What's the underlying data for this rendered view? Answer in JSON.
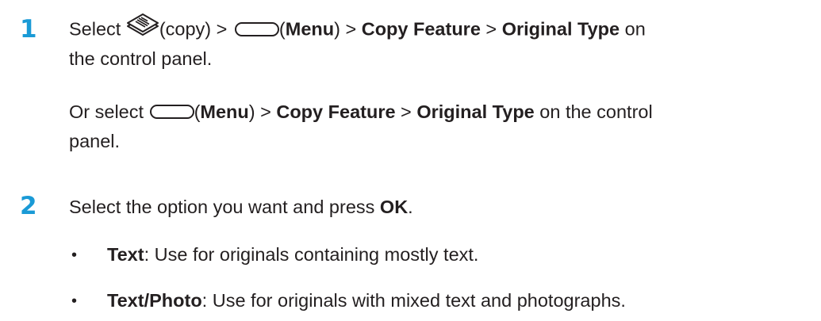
{
  "step1": {
    "number": "1",
    "line1": {
      "t1": "Select ",
      "copy_icon": "copy-icon",
      "t2": "(copy) > ",
      "menu_icon": "menu-button-icon",
      "t3": "(",
      "menu": "Menu",
      "t4": ") > ",
      "copy_feature": "Copy Feature",
      "t5": " > ",
      "original_type": "Original Type",
      "t6": " on"
    },
    "line2": "the control panel.",
    "alt": {
      "t1": "Or select ",
      "menu_icon": "menu-button-icon",
      "t2": "(",
      "menu": "Menu",
      "t3": ") > ",
      "copy_feature": "Copy Feature",
      "t4": " > ",
      "original_type": "Original Type",
      "t5": " on the control",
      "line2": "panel."
    }
  },
  "step2": {
    "number": "2",
    "t1": "Select the option you want and press ",
    "ok": "OK",
    "t2": ".",
    "bullets": [
      {
        "marker": "•",
        "term": "Text",
        "desc": ": Use for originals containing mostly text."
      },
      {
        "marker": "•",
        "term": "Text/Photo",
        "desc": ": Use for originals with mixed text and photographs."
      }
    ]
  },
  "colors": {
    "step_number": "#1a9ad6",
    "text": "#231f20"
  }
}
